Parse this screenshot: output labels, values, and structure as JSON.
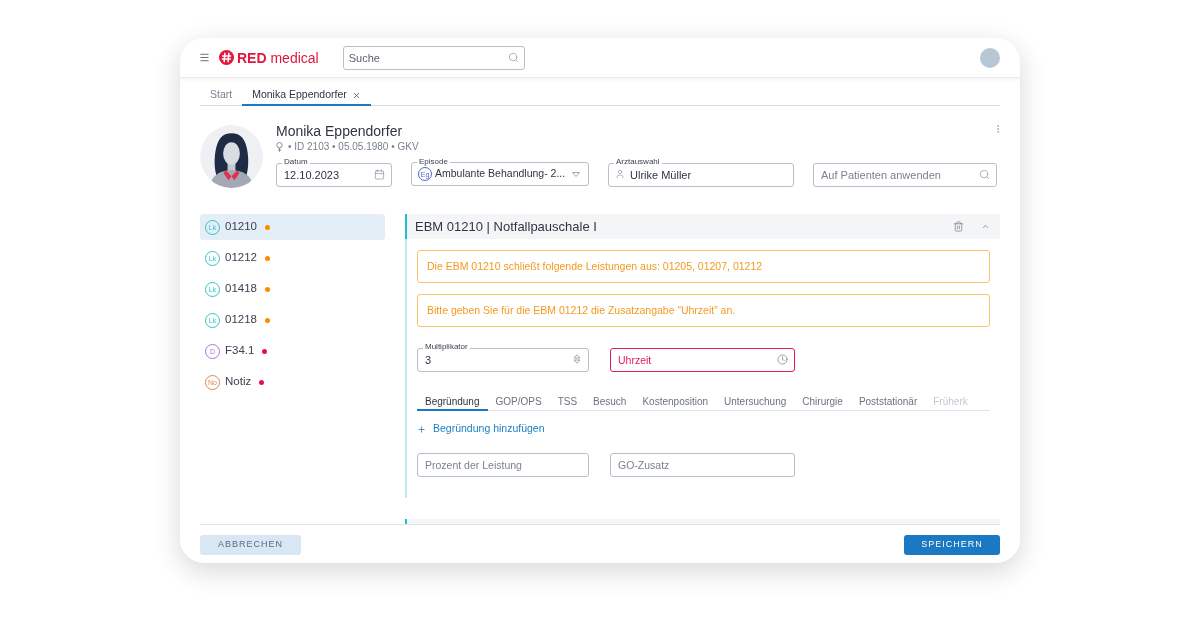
{
  "header": {
    "logo_text": "**RED** medical",
    "search": {
      "placeholder": "Suche"
    }
  },
  "tabs": [
    {
      "label": "Start",
      "selected": false,
      "closable": false
    },
    {
      "label": "Monika Eppendorfer",
      "selected": true,
      "closable": true
    }
  ],
  "patient": {
    "name": "Monika Eppendorfer",
    "info": "• ID 2103 • 05.05.1980 • GKV"
  },
  "fields": [
    {
      "kind": "date",
      "label": "Datum",
      "value": "12.10.2023"
    },
    {
      "kind": "select",
      "label": "Episode",
      "badge": "Eg",
      "value": "Ambulante Behandlung- 2..."
    },
    {
      "kind": "person",
      "label": "Arztauswahl",
      "value": "Ulrike Müller"
    },
    {
      "kind": "search",
      "placeholder": "Auf Patienten anwenden"
    }
  ],
  "services": [
    {
      "kind": "service",
      "badge": "Lk",
      "code": "01210",
      "color": "#ff8a00",
      "selected": true
    },
    {
      "kind": "service",
      "badge": "Lk",
      "code": "01212",
      "color": "#ff8a00",
      "selected": false
    },
    {
      "kind": "service",
      "badge": "Lk",
      "code": "01418",
      "color": "#ff8a00",
      "selected": false
    },
    {
      "kind": "service",
      "badge": "Lk",
      "code": "01218",
      "color": "#ff8a00",
      "selected": false
    },
    {
      "kind": "diagnosis",
      "badge": "D",
      "code": "F34.1",
      "color": "#e8104a",
      "selected": false
    },
    {
      "kind": "note",
      "badge": "No",
      "code": "Notiz",
      "color": "#e8104a",
      "selected": false
    }
  ],
  "detail": {
    "title": "EBM 01210 | Notfallpauschale I",
    "expanded": true,
    "alerts": [
      "Die EBM 01210 schließt folgende Leistungen aus: 01205, 01207, 01212",
      "Bitte geben Sie für die EBM 01212 die Zusatzangabe “Uhrzeit” an."
    ],
    "multiplier": {
      "label": "Multiplikator",
      "value": "3"
    },
    "time": {
      "placeholder": "Uhrzeit",
      "invalid": true
    },
    "tabs": [
      {
        "label": "Begründung",
        "selected": true,
        "faded": false
      },
      {
        "label": "GOP/OPS",
        "selected": false,
        "faded": false
      },
      {
        "label": "TSS",
        "selected": false,
        "faded": false
      },
      {
        "label": "Besuch",
        "selected": false,
        "faded": false
      },
      {
        "label": "Kostenposition",
        "selected": false,
        "faded": false
      },
      {
        "label": "Untersuchung",
        "selected": false,
        "faded": false
      },
      {
        "label": "Chirurgie",
        "selected": false,
        "faded": false
      },
      {
        "label": "Poststationär",
        "selected": false,
        "faded": false
      },
      {
        "label": "Früherk",
        "selected": false,
        "faded": true
      }
    ],
    "add_link": "Begründung hinzufügen",
    "inputs": [
      {
        "placeholder": "Prozent der Leistung"
      },
      {
        "placeholder": "GO-Zusatz"
      }
    ]
  },
  "footer": {
    "cancel": "ABBRECHEN",
    "save": "SPEICHERN"
  }
}
